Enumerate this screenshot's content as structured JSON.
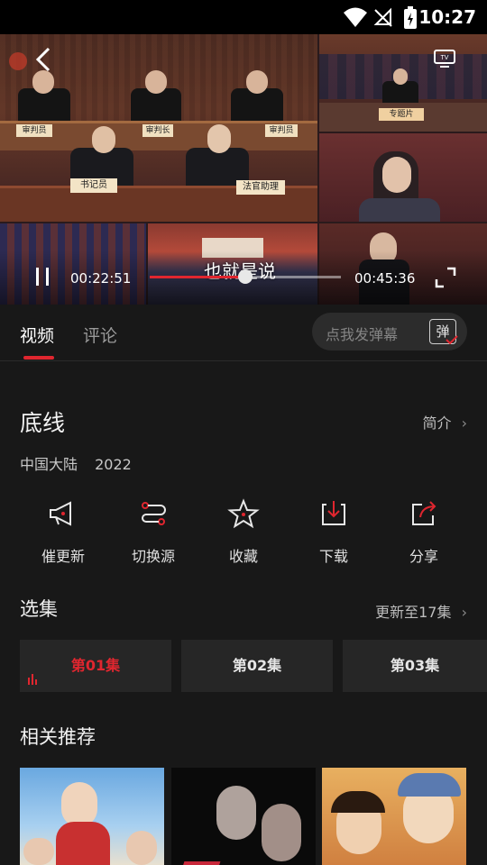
{
  "status": {
    "time": "10:27"
  },
  "player": {
    "subtitle": "也就是说",
    "current_time": "00:22:51",
    "total_time": "00:45:36",
    "progress": 0.501,
    "scene": {
      "signs": [
        "审判员",
        "审判长",
        "审判员",
        "书记员",
        "法官助理"
      ],
      "badge": "专题片"
    }
  },
  "tabs": [
    {
      "label": "视频",
      "active": true
    },
    {
      "label": "评论",
      "active": false
    }
  ],
  "danmu": {
    "placeholder": "点我发弹幕",
    "button_label": "弹"
  },
  "show": {
    "title": "底线",
    "intro_label": "简介",
    "region": "中国大陆",
    "year": "2022"
  },
  "actions": [
    {
      "label": "催更新",
      "icon": "megaphone-icon"
    },
    {
      "label": "切换源",
      "icon": "switch-source-icon"
    },
    {
      "label": "收藏",
      "icon": "star-icon"
    },
    {
      "label": "下载",
      "icon": "download-icon"
    },
    {
      "label": "分享",
      "icon": "share-icon"
    }
  ],
  "episodes_section": {
    "title": "选集",
    "more_label": "更新至17集"
  },
  "episodes": [
    {
      "label": "第01集",
      "active": true
    },
    {
      "label": "第02集",
      "active": false
    },
    {
      "label": "第03集",
      "active": false
    }
  ],
  "related_section": {
    "title": "相关推荐"
  },
  "colors": {
    "accent": "#e0262f",
    "bg": "#181818",
    "card": "#262626"
  }
}
